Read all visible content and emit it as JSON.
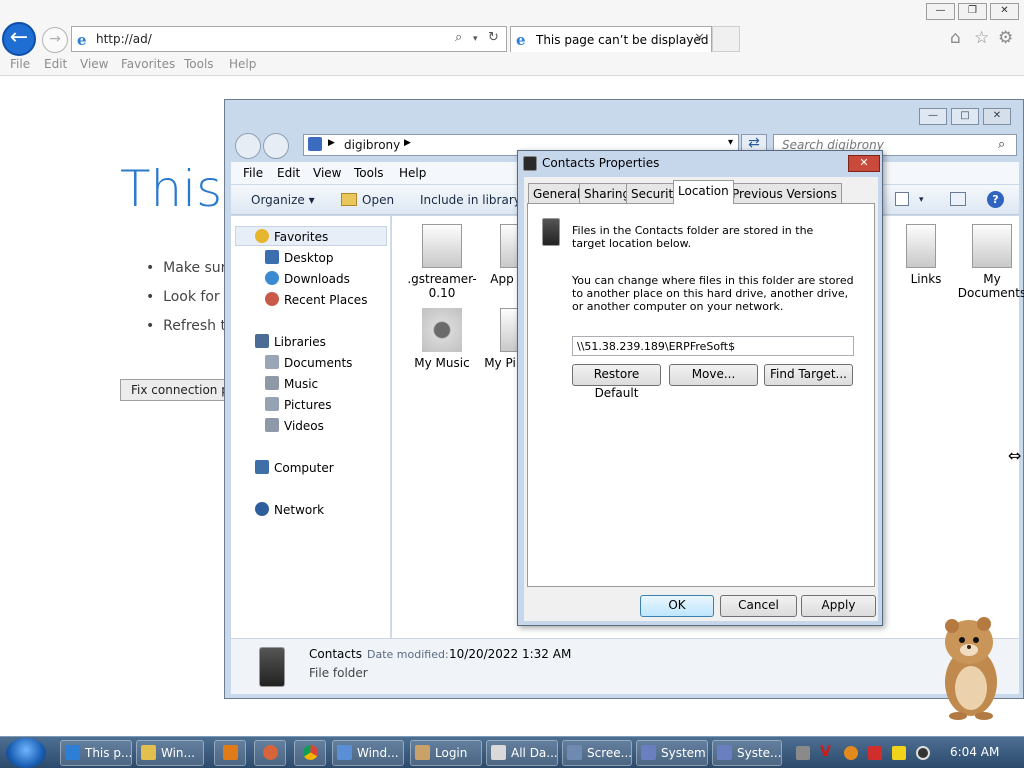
{
  "browser": {
    "address": "http://ad/",
    "tab_title": "This page can’t be displayed",
    "menu": [
      "File",
      "Edit",
      "View",
      "Favorites",
      "Tools",
      "Help"
    ],
    "error_page": {
      "title": "This p",
      "bullets": [
        "Make sure",
        "Look for t",
        "Refresh th"
      ],
      "fix_button": "Fix connection pr"
    }
  },
  "explorer": {
    "breadcrumb": "digibrony",
    "search_placeholder": "Search digibrony",
    "menu": [
      "File",
      "Edit",
      "View",
      "Tools",
      "Help"
    ],
    "toolbar": {
      "organize": "Organize",
      "open": "Open",
      "include": "Include in library"
    },
    "nav": {
      "favorites": "Favorites",
      "desktop": "Desktop",
      "downloads": "Downloads",
      "recent": "Recent Places",
      "libraries": "Libraries",
      "documents": "Documents",
      "music": "Music",
      "pictures": "Pictures",
      "videos": "Videos",
      "computer": "Computer",
      "network": "Network"
    },
    "files": {
      "gstreamer": ".gstreamer-\n0.10",
      "app": "App",
      "my_music": "My Music",
      "my_pi": "My Pi",
      "links": "Links",
      "my_documents": "My\nDocuments"
    },
    "details": {
      "name": "Contacts",
      "date_label": "Date modified:",
      "date_value": "10/20/2022 1:32 AM",
      "type": "File folder"
    }
  },
  "dialog": {
    "title": "Contacts Properties",
    "tabs": [
      "General",
      "Sharing",
      "Security",
      "Location",
      "Previous Versions"
    ],
    "info1": "Files in the Contacts folder are stored in the target location below.",
    "info2": "You can change where files in this folder are stored to another place on this hard drive, another drive, or another computer on your network.",
    "location_path": "\\\\51.38.239.189\\ERPFreSoft$",
    "buttons": {
      "restore": "Restore Default",
      "move": "Move...",
      "find": "Find Target...",
      "ok": "OK",
      "cancel": "Cancel",
      "apply": "Apply"
    }
  },
  "taskbar": {
    "items": [
      "This p...",
      "Win...",
      "Wind...",
      "Login",
      "All Da...",
      "Scree...",
      "System",
      "Syste..."
    ],
    "clock": "6:04 AM"
  }
}
